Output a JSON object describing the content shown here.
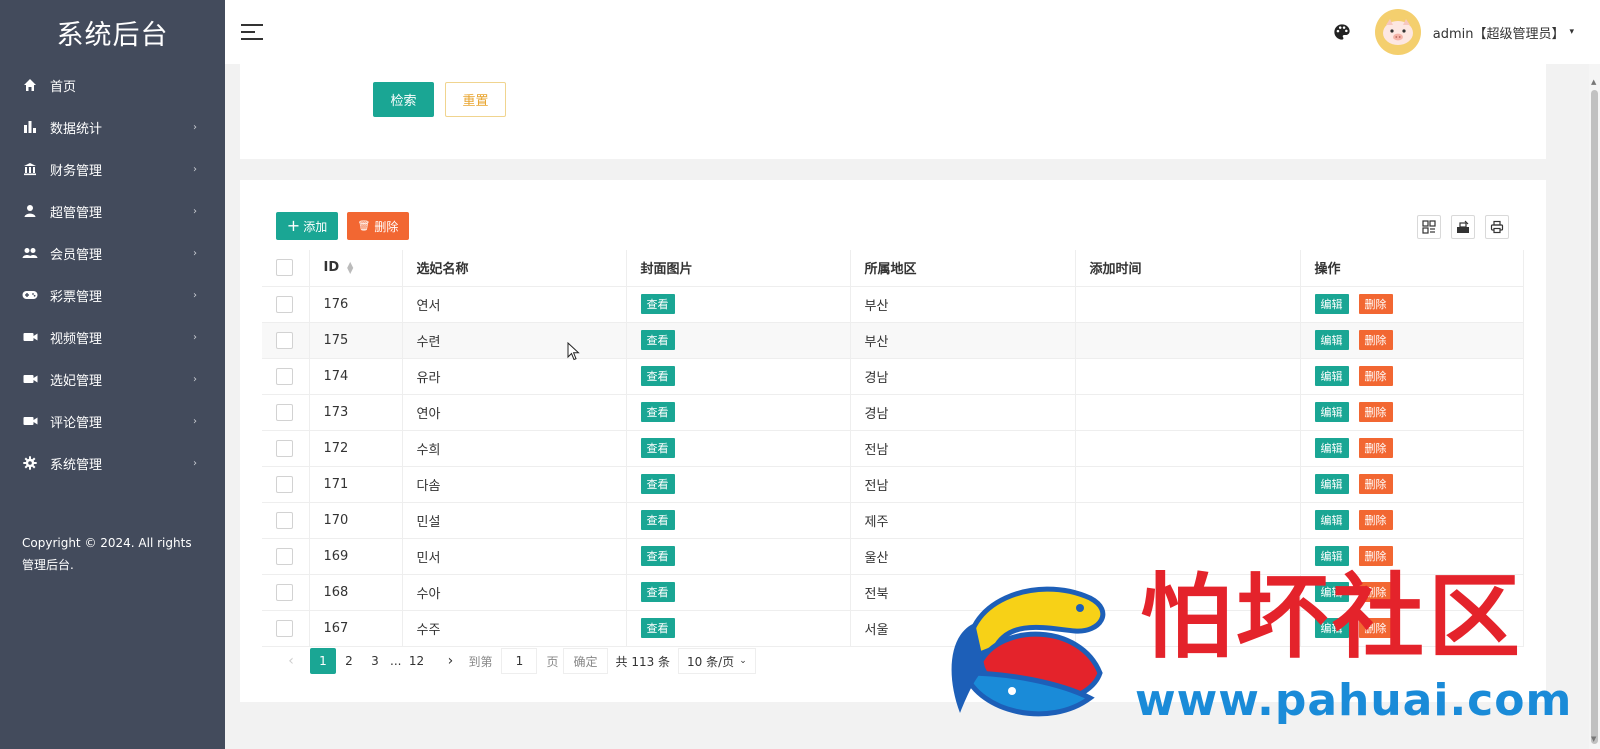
{
  "sidebar": {
    "logo": "系统后台",
    "items": [
      {
        "label": "首页",
        "icon": "home-icon",
        "has_arrow": false
      },
      {
        "label": "数据统计",
        "icon": "bar-chart-icon",
        "has_arrow": true
      },
      {
        "label": "财务管理",
        "icon": "bank-icon",
        "has_arrow": true
      },
      {
        "label": "超管管理",
        "icon": "user-icon",
        "has_arrow": true
      },
      {
        "label": "会员管理",
        "icon": "users-icon",
        "has_arrow": true
      },
      {
        "label": "彩票管理",
        "icon": "gamepad-icon",
        "has_arrow": true
      },
      {
        "label": "视频管理",
        "icon": "video-icon",
        "has_arrow": true
      },
      {
        "label": "选妃管理",
        "icon": "video-icon",
        "has_arrow": true
      },
      {
        "label": "评论管理",
        "icon": "video-icon",
        "has_arrow": true
      },
      {
        "label": "系统管理",
        "icon": "gear-icon",
        "has_arrow": true
      }
    ],
    "arrow": "›",
    "copyright": "Copyright © 2024. All rights 管理后台."
  },
  "header": {
    "user_name": "admin【超级管理员】",
    "caret": "▾"
  },
  "search": {
    "search_label": "检索",
    "reset_label": "重置"
  },
  "toolbar": {
    "add_label": "添加",
    "delete_label": "删除"
  },
  "table": {
    "columns": [
      "ID",
      "选妃名称",
      "封面图片",
      "所属地区",
      "添加时间",
      "操作"
    ],
    "view_label": "查看",
    "edit_label": "编辑",
    "remove_label": "删除",
    "rows": [
      {
        "id": "176",
        "name": "연서",
        "region": "부산",
        "time": ""
      },
      {
        "id": "175",
        "name": "수련",
        "region": "부산",
        "time": ""
      },
      {
        "id": "174",
        "name": "유라",
        "region": "경남",
        "time": ""
      },
      {
        "id": "173",
        "name": "연아",
        "region": "경남",
        "time": ""
      },
      {
        "id": "172",
        "name": "수희",
        "region": "전남",
        "time": ""
      },
      {
        "id": "171",
        "name": "다솜",
        "region": "전남",
        "time": ""
      },
      {
        "id": "170",
        "name": "민설",
        "region": "제주",
        "time": ""
      },
      {
        "id": "169",
        "name": "민서",
        "region": "울산",
        "time": ""
      },
      {
        "id": "168",
        "name": "수아",
        "region": "전북",
        "time": ""
      },
      {
        "id": "167",
        "name": "수주",
        "region": "서울",
        "time": ""
      }
    ]
  },
  "pagination": {
    "prev": "‹",
    "pages": [
      "1",
      "2",
      "3"
    ],
    "ellipsis": "...",
    "last_page": "12",
    "next": "›",
    "goto_label": "到第",
    "goto_value": "1",
    "page_label": "页",
    "confirm_label": "确定",
    "total_label": "共 113 条",
    "page_size_label": "10 条/页",
    "dropdown": "⌄"
  },
  "watermark": {
    "title": "怕坏社区",
    "url": "www.pahuai.com"
  }
}
